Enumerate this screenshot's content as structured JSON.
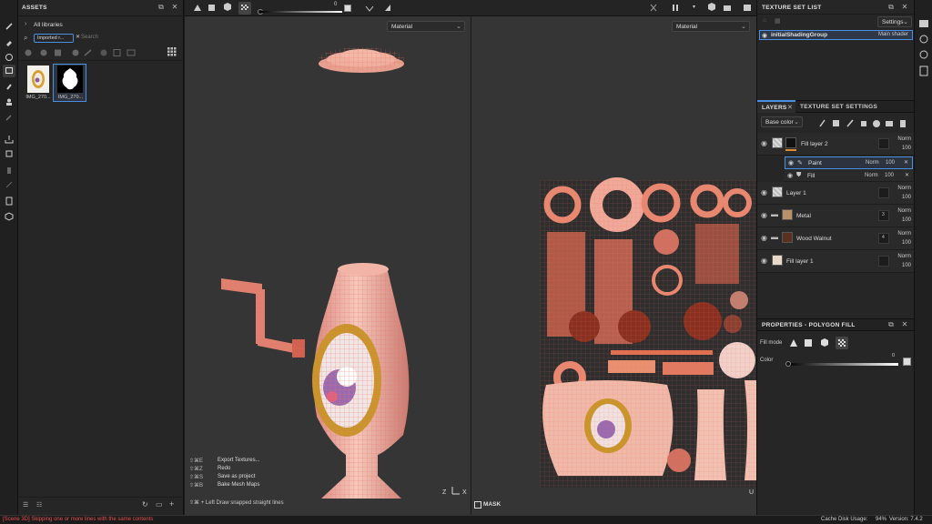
{
  "assets": {
    "title": "ASSETS",
    "libraries_label": "All libraries",
    "filter_chip": "Imported r...",
    "search_placeholder": "Search",
    "items": [
      {
        "label": "IMG_270..."
      },
      {
        "label": "IMG_270..."
      }
    ]
  },
  "viewport": {
    "slider_value": "0",
    "left_dropdown": "Material",
    "right_dropdown": "Material",
    "shortcuts": [
      {
        "keys": "⇧⌘E",
        "action": "Export Textures..."
      },
      {
        "keys": "⇧⌘Z",
        "action": "Redo"
      },
      {
        "keys": "⇧⌘S",
        "action": "Save as project"
      },
      {
        "keys": "⇧⌘B",
        "action": "Bake Mesh Maps"
      }
    ],
    "hint": "⇧⌘ + Left Draw snapped straight lines",
    "mask_label": "MASK",
    "axis_z": "Z",
    "axis_x": "X",
    "axis_u": "U"
  },
  "texture_set_list": {
    "title": "TEXTURE SET LIST",
    "settings_label": "Settings",
    "set_name": "initialShadingGroup",
    "shader": "Main shader"
  },
  "layers": {
    "tab_layers": "LAYERS",
    "tab_settings": "TEXTURE SET SETTINGS",
    "channel": "Base color",
    "rows": [
      {
        "name": "Fill layer 2",
        "blend": "Norm",
        "opacity": "100"
      },
      {
        "name": "Paint",
        "blend": "Norm",
        "opacity": "100"
      },
      {
        "name": "Fill",
        "blend": "Norm",
        "opacity": "100"
      },
      {
        "name": "Layer 1",
        "blend": "Norm",
        "opacity": "100"
      },
      {
        "name": "Metal",
        "blend": "Norm",
        "opacity": "100",
        "badge": "3"
      },
      {
        "name": "Wood Walnut",
        "blend": "Norm",
        "opacity": "100",
        "badge": "4"
      },
      {
        "name": "Fill layer 1",
        "blend": "Norm",
        "opacity": "100"
      }
    ]
  },
  "properties": {
    "title": "PROPERTIES - POLYGON FILL",
    "fill_mode_label": "Fill mode",
    "color_label": "Color",
    "color_value": "0"
  },
  "status": {
    "message": "[Scene 3D] Skipping one or more lines with the same contents",
    "cache": "Cache Disk Usage:",
    "cache_value": "94%",
    "version": "Version: 7.4.2"
  },
  "colors": {
    "accent_blue": "#4a90e2",
    "error_text": "#e05050",
    "model_pink": "#e8a090",
    "wire_orange": "#f06040"
  }
}
